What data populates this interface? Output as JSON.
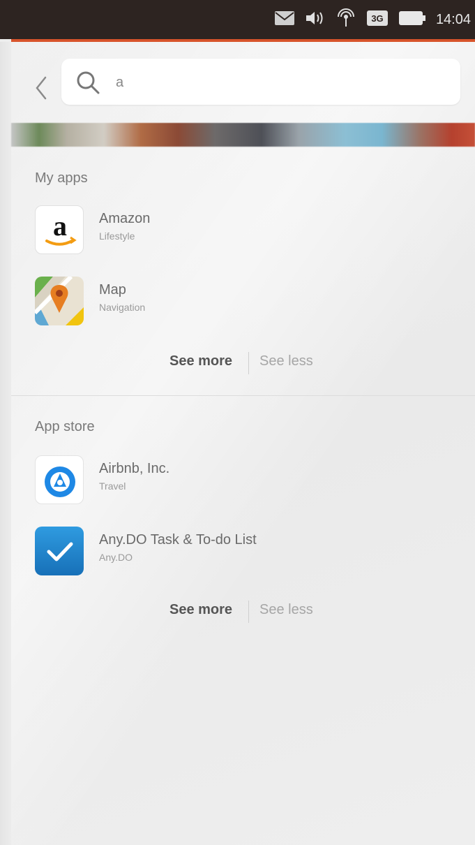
{
  "status_bar": {
    "icons": [
      "mail-icon",
      "volume-icon",
      "wifi-icon",
      "network-3g-icon",
      "battery-icon"
    ],
    "network_label": "3G",
    "time": "14:04",
    "accent_color": "#d7542b",
    "background_color": "#2d2421"
  },
  "search": {
    "query": "a",
    "back_icon": "chevron-left-icon",
    "search_icon": "search-icon"
  },
  "sections": {
    "my_apps": {
      "title": "My apps",
      "apps": [
        {
          "name": "Amazon",
          "category": "Lifestyle",
          "icon": "amazon-icon"
        },
        {
          "name": "Map",
          "category": "Navigation",
          "icon": "map-icon"
        }
      ],
      "see_more": "See more",
      "see_less": "See less"
    },
    "app_store": {
      "title": "App store",
      "apps": [
        {
          "name": "Airbnb, Inc.",
          "category": "Travel",
          "icon": "airbnb-icon"
        },
        {
          "name": "Any.DO Task & To-do List",
          "category": "Any.DO",
          "icon": "anydo-icon"
        }
      ],
      "see_more": "See more",
      "see_less": "See less"
    }
  }
}
